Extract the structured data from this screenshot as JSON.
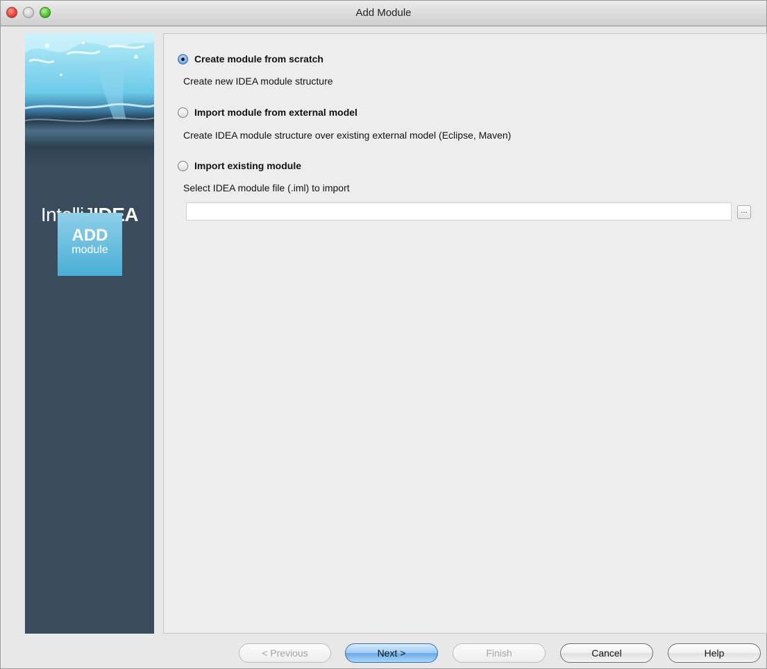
{
  "window": {
    "title": "Add Module"
  },
  "sidebar": {
    "brand_prefix": "IntelliJ",
    "brand_bold": "IDEA",
    "badge_big": "ADD",
    "badge_small": "module"
  },
  "options": [
    {
      "label": "Create module from scratch",
      "description": "Create new IDEA module structure",
      "selected": true
    },
    {
      "label": "Import module from external model",
      "description": "Create IDEA module structure over existing external model (Eclipse, Maven)",
      "selected": false
    },
    {
      "label": "Import existing module",
      "description": "Select IDEA module file (.iml) to import",
      "selected": false
    }
  ],
  "import_path": {
    "value": "",
    "browse_label": "..."
  },
  "buttons": {
    "previous": "< Previous",
    "next": "Next >",
    "finish": "Finish",
    "cancel": "Cancel",
    "help": "Help"
  },
  "colors": {
    "sidebar_bg": "#3a4b5e",
    "badge_bg": "#4aaed6",
    "panel_bg": "#ededed",
    "primary_button": "#6aa9e8"
  }
}
